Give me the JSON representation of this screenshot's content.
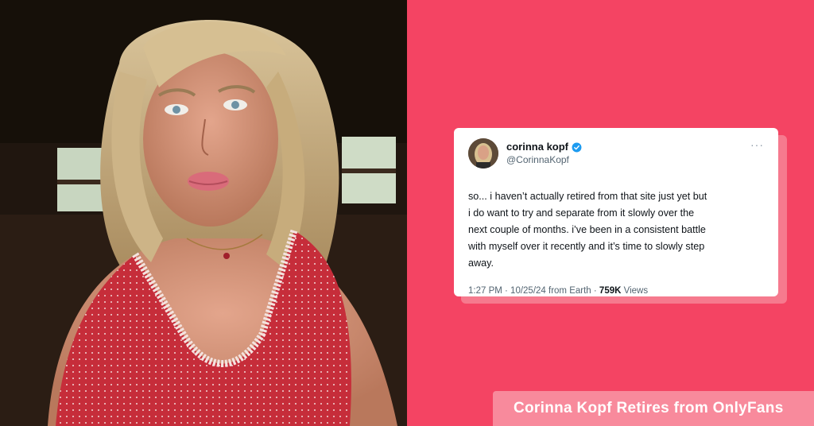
{
  "photo": {
    "icon": "portrait-photo"
  },
  "tweet": {
    "display_name": "corinna kopf",
    "handle": "@CorinnaKopf",
    "verified_icon": "verified-badge-icon",
    "more_icon": "···",
    "text": "so... i haven’t actually retired from that site just yet but\ni do want to try and separate from it slowly over the\nnext couple of months. i’ve been in a consistent battle\nwith myself over it recently and it’s time to slowly step\naway.",
    "meta_prefix": "1:27 PM · 10/25/24 from Earth · ",
    "views_count": "759K",
    "views_label": " Views"
  },
  "caption": {
    "text": "Corinna Kopf Retires from OnlyFans"
  },
  "colors": {
    "background": "#f44463",
    "caption_bg": "#f88a9c",
    "verified": "#1d9bf0"
  }
}
